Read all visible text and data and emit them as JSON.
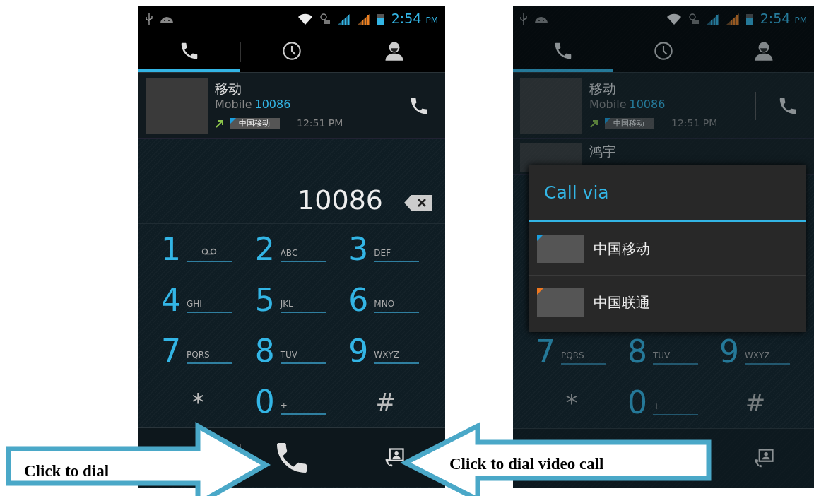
{
  "phones": [
    {
      "dimmed": false,
      "status_time": "2:54",
      "status_ampm": "PM",
      "tabs": [
        {
          "kind": "dialer",
          "selected": true
        },
        {
          "kind": "recent",
          "selected": false
        },
        {
          "kind": "contacts",
          "selected": false
        }
      ],
      "call_log": [
        {
          "name": "移动",
          "number_type": "Mobile",
          "number": "10086",
          "sim": "中国移动",
          "time": "12:51 PM"
        }
      ],
      "dialed_number": "10086",
      "keypad": [
        {
          "digit": "1",
          "kind": "voicemail"
        },
        {
          "digit": "2",
          "letters": "ABC",
          "kind": "digit"
        },
        {
          "digit": "3",
          "letters": "DEF",
          "kind": "digit"
        },
        {
          "digit": "4",
          "letters": "GHI",
          "kind": "digit"
        },
        {
          "digit": "5",
          "letters": "JKL",
          "kind": "digit"
        },
        {
          "digit": "6",
          "letters": "MNO",
          "kind": "digit"
        },
        {
          "digit": "7",
          "letters": "PQRS",
          "kind": "digit"
        },
        {
          "digit": "8",
          "letters": "TUV",
          "kind": "digit"
        },
        {
          "digit": "9",
          "letters": "WXYZ",
          "kind": "digit"
        },
        {
          "digit": "*",
          "kind": "symbol"
        },
        {
          "digit": "0",
          "letters": "+",
          "kind": "digit"
        },
        {
          "digit": "#",
          "kind": "symbol"
        }
      ],
      "actions": [
        {
          "kind": "dial"
        },
        {
          "kind": "video_call"
        }
      ]
    },
    {
      "dimmed": true,
      "status_time": "2:54",
      "status_ampm": "PM",
      "tabs": [
        {
          "kind": "dialer",
          "selected": true
        },
        {
          "kind": "recent",
          "selected": false
        },
        {
          "kind": "contacts",
          "selected": false
        }
      ],
      "call_log": [
        {
          "name": "移动",
          "number_type": "Mobile",
          "number": "10086",
          "sim": "中国移动",
          "time": "12:51 PM"
        },
        {
          "name": "鸿宇"
        }
      ],
      "keypad": [
        {
          "digit": "7",
          "letters": "PQRS",
          "kind": "digit"
        },
        {
          "digit": "8",
          "letters": "TUV",
          "kind": "digit"
        },
        {
          "digit": "9",
          "letters": "WXYZ",
          "kind": "digit"
        },
        {
          "digit": "*",
          "kind": "symbol"
        },
        {
          "digit": "0",
          "letters": "+",
          "kind": "digit"
        },
        {
          "digit": "#",
          "kind": "symbol"
        }
      ],
      "actions": [
        {
          "kind": "video_call"
        }
      ],
      "dialog": {
        "title": "Call via",
        "options": [
          {
            "label": "中国移动",
            "color": "#1a9fe0"
          },
          {
            "label": "中国联通",
            "color": "#f07820"
          }
        ]
      }
    }
  ],
  "callouts": [
    {
      "text": "Click to dial",
      "kind": "right_arrow"
    },
    {
      "text": "Click to dial video call",
      "kind": "left_arrow"
    }
  ]
}
